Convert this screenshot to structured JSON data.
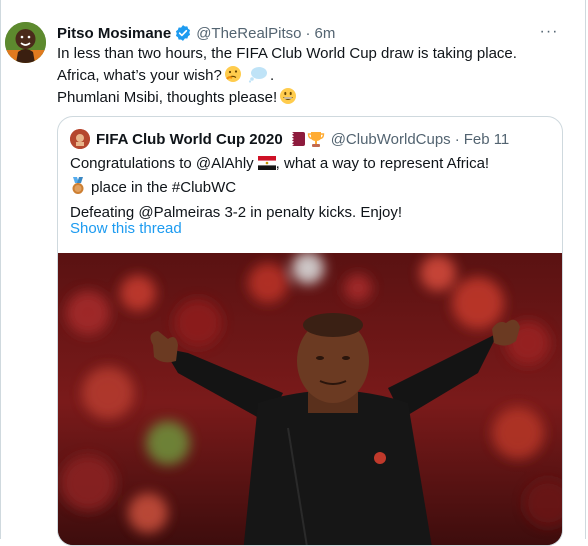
{
  "tweet": {
    "display_name": "Pitso Mosimane",
    "handle": "@TheRealPitso",
    "separator": "·",
    "time": "6m",
    "more_label": "···",
    "text_line1": "In less than two hours, the FIFA Club World Cup draw is taking place.",
    "text_line2a": "Africa, what’s your wish?",
    "text_line2b": " .",
    "text_line3": "Phumlani Msibi, thoughts please!",
    "emojis": [
      "thinking-face",
      "speech-balloon",
      "grinning-face"
    ]
  },
  "quote": {
    "display_name": "FIFA Club World Cup 2020",
    "name_emojis": [
      "qatar-flag",
      "trophy"
    ],
    "handle": "@ClubWorldCups",
    "separator": "·",
    "date": "Feb 11",
    "text_line1a": "Congratulations to @AlAhly",
    "text_line1b": ", what a way to represent Africa!",
    "text_line2": "place in the #ClubWC",
    "text_line3": "Defeating @Palmeiras 3-2 in penalty kicks. Enjoy!",
    "line_emojis": [
      "egypt-flag",
      "bronze-medal"
    ],
    "show_thread": "Show this thread"
  },
  "colors": {
    "link": "#1d9bf0",
    "secondary_text": "#536471",
    "border": "#cfd9de",
    "verified": "#1d9bf0"
  }
}
